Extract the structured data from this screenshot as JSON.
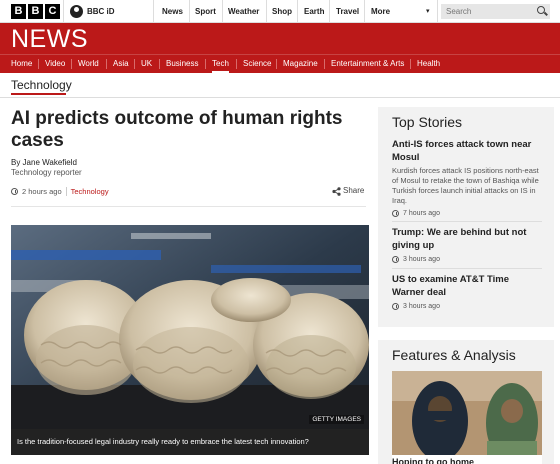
{
  "header": {
    "logo_letters": [
      "B",
      "B",
      "C"
    ],
    "bbc_id": "BBC iD",
    "nav": [
      "News",
      "Sport",
      "Weather",
      "Shop",
      "Earth",
      "Travel",
      "More"
    ],
    "search_placeholder": "Search"
  },
  "banner": {
    "title": "NEWS"
  },
  "section_nav": {
    "items": [
      "Home",
      "Video",
      "World",
      "Asia",
      "UK",
      "Business",
      "Tech",
      "Science",
      "Magazine",
      "Entertainment & Arts",
      "Health"
    ],
    "active": "Tech"
  },
  "breadcrumb": "Technology",
  "article": {
    "headline": "AI predicts outcome of human rights cases",
    "author": "By Jane Wakefield",
    "role": "Technology reporter",
    "time": "2 hours ago",
    "tag": "Technology",
    "share_label": "Share",
    "image_credit": "GETTY IMAGES",
    "image_caption": "Is the tradition-focused legal industry really ready to embrace the latest tech innovation?"
  },
  "top_stories": {
    "title": "Top Stories",
    "stories": [
      {
        "headline": "Anti-IS forces attack town near Mosul",
        "summary": "Kurdish forces attack IS positions north-east of Mosul to retake the town of Bashiqa while Turkish forces launch initial attacks on IS in Iraq.",
        "time": "7 hours ago"
      },
      {
        "headline": "Trump: We are behind but not giving up",
        "time": "3 hours ago"
      },
      {
        "headline": "US to examine AT&T Time Warner deal",
        "time": "3 hours ago"
      }
    ]
  },
  "features": {
    "title": "Features & Analysis",
    "first_caption": "Hoping to go home"
  },
  "colors": {
    "brand_red": "#bb1919",
    "sidebar_bg": "#f2f2f2"
  }
}
